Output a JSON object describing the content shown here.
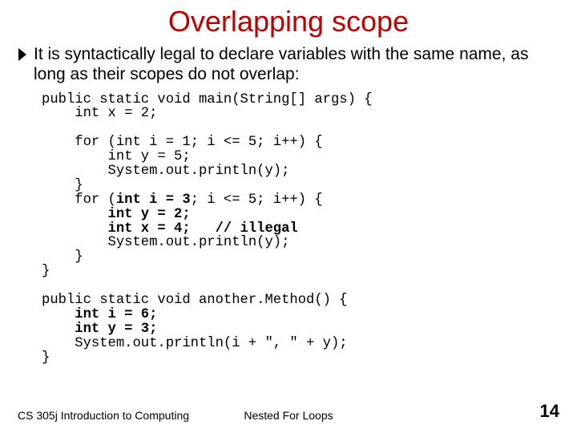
{
  "title": "Overlapping scope",
  "bullet": "It is syntactically legal to declare variables with the same name, as long as their scopes do not overlap:",
  "code": {
    "l1": "public static void main(String[] args) {",
    "l2": "    int x = 2;",
    "l3": "",
    "l4": "    for (int i = 1; i <= 5; i++) {",
    "l5": "        int y = 5;",
    "l6": "        System.out.println(y);",
    "l7": "    }",
    "l8a": "    for (",
    "l8b": "int i = 3",
    "l8c": "; i <= 5; i++) {",
    "l9a": "        ",
    "l9b": "int y = 2;",
    "l10a": "        ",
    "l10b": "int x = 4;   // illegal",
    "l11": "        System.out.println(y);",
    "l12": "    }",
    "l13": "}",
    "l14": "",
    "l15": "public static void another.Method() {",
    "l16a": "    ",
    "l16b": "int i = 6;",
    "l17a": "    ",
    "l17b": "int y = 3;",
    "l18": "    System.out.println(i + \", \" + y);",
    "l19": "}"
  },
  "footer": {
    "left": "CS 305j Introduction to Computing",
    "center": "Nested For Loops",
    "right": "14"
  }
}
